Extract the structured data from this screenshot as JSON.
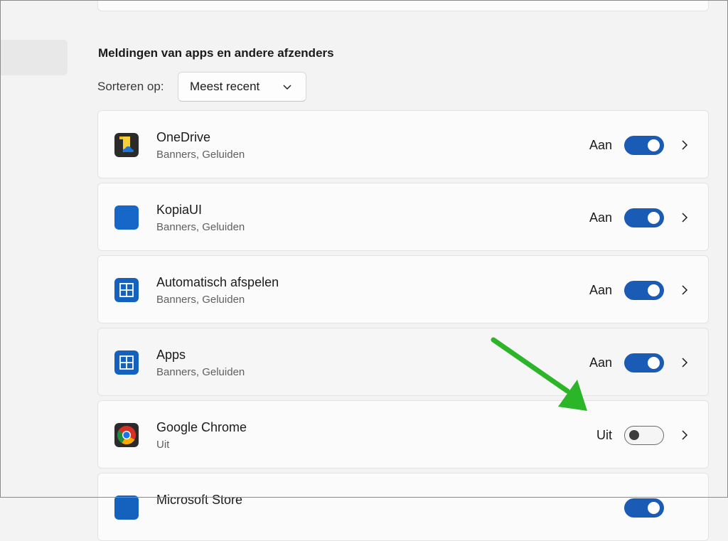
{
  "section": {
    "title": "Meldingen van apps en andere afzenders",
    "sort_label": "Sorteren op:",
    "sort_value": "Meest recent"
  },
  "apps": [
    {
      "name": "OneDrive",
      "subtitle": "Banners, Geluiden",
      "state": "Aan",
      "icon": "onedrive-icon"
    },
    {
      "name": "KopiaUI",
      "subtitle": "Banners, Geluiden",
      "state": "Aan",
      "icon": "kopiaui-icon"
    },
    {
      "name": "Automatisch afspelen",
      "subtitle": "Banners, Geluiden",
      "state": "Aan",
      "icon": "autoplay-icon"
    },
    {
      "name": "Apps",
      "subtitle": "Banners, Geluiden",
      "state": "Aan",
      "icon": "apps-icon"
    },
    {
      "name": "Google Chrome",
      "subtitle": "Uit",
      "state": "Uit",
      "icon": "chrome-icon"
    },
    {
      "name": "Microsoft Store",
      "subtitle": "",
      "state": "Aan",
      "icon": "store-icon"
    }
  ],
  "toggles": [
    true,
    true,
    true,
    true,
    false,
    true
  ],
  "colors": {
    "accent": "#1a5bb5",
    "annotation_arrow": "#2db52a",
    "background": "#f3f3f3"
  }
}
